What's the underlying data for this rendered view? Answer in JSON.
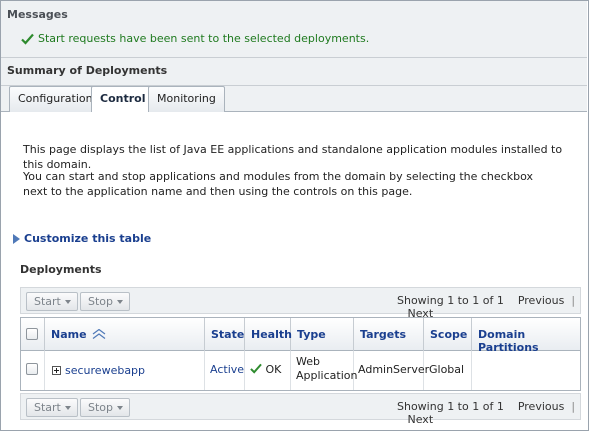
{
  "messages": {
    "title": "Messages",
    "text": "Start requests have been sent to the selected deployments."
  },
  "summary": {
    "title": "Summary of Deployments"
  },
  "tabs": [
    {
      "label": "Configuration",
      "active": false
    },
    {
      "label": "Control",
      "active": true
    },
    {
      "label": "Monitoring",
      "active": false
    }
  ],
  "intro": {
    "p1": "This page displays the list of Java EE applications and standalone application modules installed to this domain.",
    "p2": "You can start and stop applications and modules from the domain by selecting the checkbox next to the application name and then using the controls on this page."
  },
  "customize_label": "Customize this table",
  "deployments": {
    "title": "Deployments",
    "toolbar": {
      "start_label": "Start",
      "stop_label": "Stop",
      "showing": "Showing 1 to 1 of 1",
      "previous": "Previous",
      "separator": "|",
      "next": "Next"
    },
    "columns": {
      "name": "Name",
      "state": "State",
      "health": "Health",
      "type": "Type",
      "targets": "Targets",
      "scope": "Scope",
      "domain_partitions": "Domain Partitions"
    },
    "rows": [
      {
        "name": "securewebapp",
        "state": "Active",
        "health": "OK",
        "type_line1": "Web",
        "type_line2": "Application",
        "targets": "AdminServer",
        "scope": "Global",
        "domain_partitions": ""
      }
    ]
  },
  "colors": {
    "success": "#1f7a1f",
    "link": "#1a3f8f",
    "panel_bg": "#eef1f3"
  }
}
